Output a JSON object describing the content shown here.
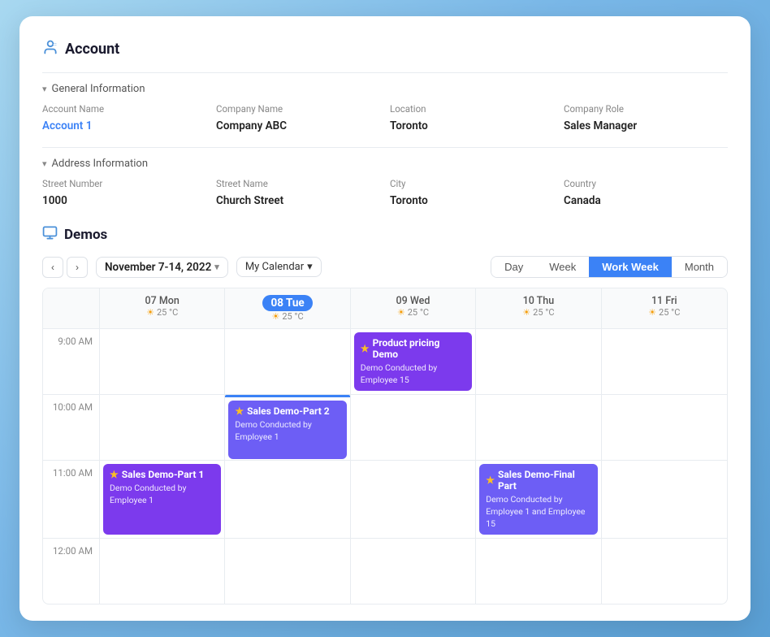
{
  "account": {
    "title": "Account",
    "icon": "👤",
    "general": {
      "section_label": "General Information",
      "fields": [
        {
          "label": "Account  Name",
          "value": "Account 1",
          "is_link": true
        },
        {
          "label": "Company Name",
          "value": "Company ABC"
        },
        {
          "label": "Location",
          "value": "Toronto"
        },
        {
          "label": "Company Role",
          "value": "Sales Manager"
        }
      ]
    },
    "address": {
      "section_label": "Address Information",
      "fields": [
        {
          "label": "Street Number",
          "value": "1000"
        },
        {
          "label": "Street Name",
          "value": "Church Street"
        },
        {
          "label": "City",
          "value": "Toronto"
        },
        {
          "label": "Country",
          "value": "Canada"
        }
      ]
    }
  },
  "demos": {
    "title": "Demos",
    "calendar": {
      "date_range": "November 7-14, 2022",
      "calendar_name": "My Calendar",
      "views": [
        "Day",
        "Week",
        "Work Week",
        "Month"
      ],
      "active_view": "Work Week",
      "days": [
        {
          "name": "Mon",
          "num": "07",
          "today": false,
          "temp": "25 °C"
        },
        {
          "name": "Tue",
          "num": "08",
          "today": true,
          "temp": "25 °C"
        },
        {
          "name": "Wed",
          "num": "09",
          "today": false,
          "temp": "25 °C"
        },
        {
          "name": "Thu",
          "num": "10",
          "today": false,
          "temp": "25 °C"
        },
        {
          "name": "Fri",
          "num": "11",
          "today": false,
          "temp": "25 °C"
        }
      ],
      "time_slots": [
        {
          "time": "9:00 AM",
          "events": [
            {
              "day_index": 2,
              "title": "Product pricing Demo",
              "sub": "Demo Conducted by\nEmployee 15",
              "color": "purple",
              "has_indicator": false
            }
          ]
        },
        {
          "time": "10:00 AM",
          "events": [
            {
              "day_index": 1,
              "title": "Sales Demo-Part 2",
              "sub": "Demo Conducted by\nEmployee 1",
              "color": "blue-purple",
              "has_indicator": true
            }
          ]
        },
        {
          "time": "11:00 AM",
          "events": [
            {
              "day_index": 0,
              "title": "Sales Demo-Part 1",
              "sub": "Demo Conducted by\nEmployee 1",
              "color": "purple",
              "has_indicator": false
            },
            {
              "day_index": 3,
              "title": "Sales Demo-Final Part",
              "sub": "Demo Conducted by\nEmployee 1 and Employee 15",
              "color": "blue-purple",
              "has_indicator": false
            }
          ]
        },
        {
          "time": "12:00 AM",
          "events": []
        }
      ]
    }
  },
  "nav": {
    "prev_label": "‹",
    "next_label": "›",
    "dropdown_arrow": "▾"
  }
}
